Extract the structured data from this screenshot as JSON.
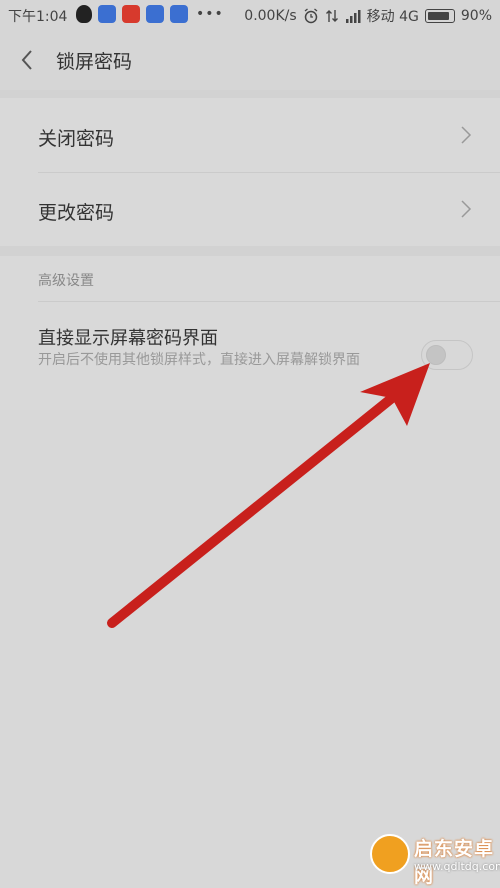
{
  "status_bar": {
    "time": "下午1:04",
    "network_speed": "0.00K/s",
    "carrier": "移动 4G",
    "battery": "90%",
    "battery_level": 0.9,
    "more": "•••"
  },
  "header": {
    "title": "锁屏密码"
  },
  "password_items": [
    {
      "label": "关闭密码"
    },
    {
      "label": "更改密码"
    }
  ],
  "advanced": {
    "section_title": "高级设置",
    "option_title": "直接显示屏幕密码界面",
    "option_desc": "开启后不使用其他锁屏样式，直接进入屏幕解锁界面",
    "toggle_on": false
  },
  "colors": {
    "arrow": "#c8201c",
    "background": "#d8d8d8"
  },
  "watermark": {
    "name": "启东安卓网",
    "url": "www.qdltdq.com"
  }
}
